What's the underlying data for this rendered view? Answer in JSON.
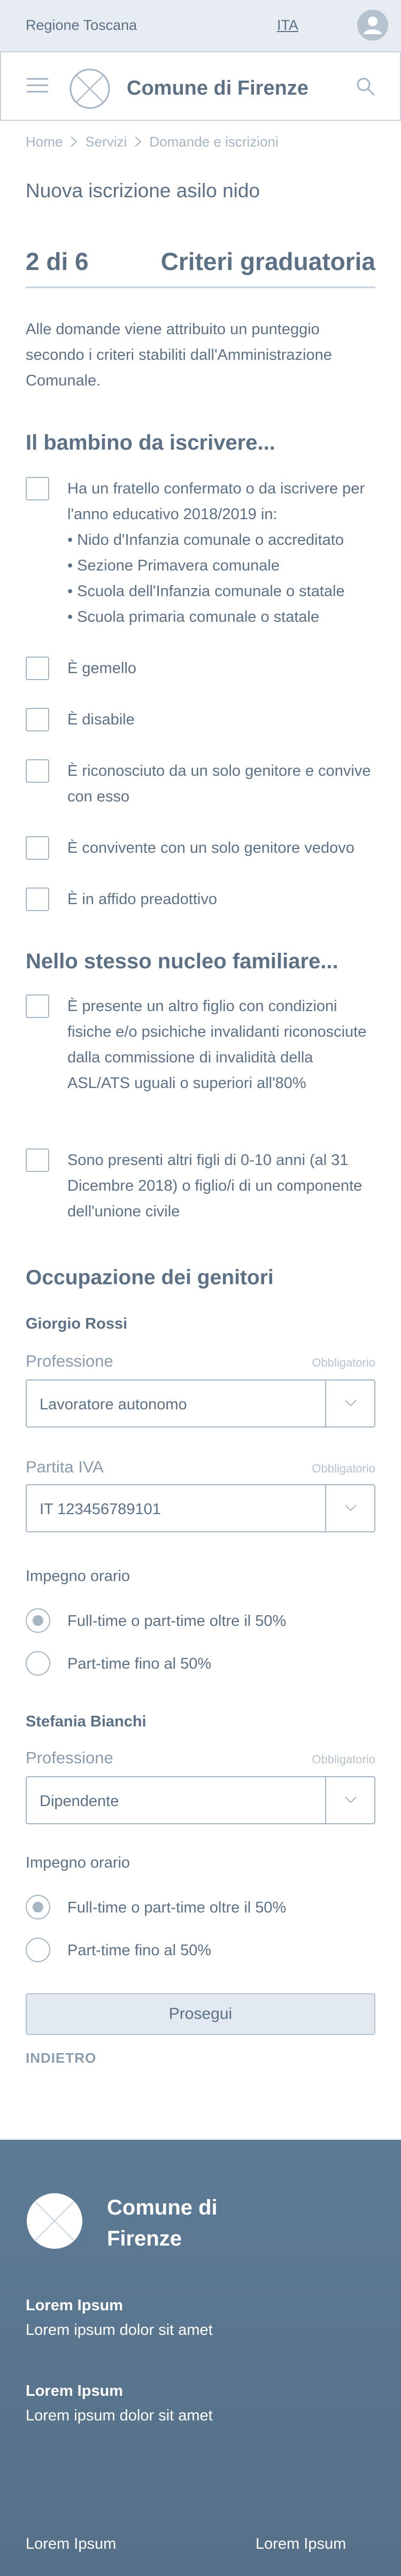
{
  "topbar": {
    "region": "Regione Toscana",
    "language": "ITA"
  },
  "header": {
    "site_title": "Comune di Firenze"
  },
  "breadcrumb": [
    "Home",
    "Servizi",
    "Domande e iscrizioni"
  ],
  "page_title": "Nuova iscrizione asilo nido",
  "step": {
    "number": "2 di 6",
    "name": "Criteri graduatoria"
  },
  "intro": "Alle domande viene attribuito un punteggio secondo i criteri stabiliti dall'Amministrazione Comunale.",
  "child_section": {
    "title": "Il bambino da iscrivere...",
    "sibling_option": {
      "label": "Ha un fratello confermato o da iscrivere per l'anno educativo 2018/2019 in:",
      "bullets": [
        "Nido d'Infanzia comunale o accreditato",
        "Sezione Primavera comunale",
        "Scuola dell'Infanzia comunale o statale",
        "Scuola primaria comunale o statale"
      ]
    },
    "options": [
      "È gemello",
      "È disabile",
      "È riconosciuto da un solo genitore e convive con esso",
      "È convivente con un solo genitore vedovo",
      "È in affido preadottivo"
    ]
  },
  "family_section": {
    "title": "Nello stesso nucleo familiare...",
    "options": [
      "È presente un altro figlio con condizioni fisiche e/o psichiche invalidanti riconosciute dalla commissione di invalidità della ASL/ATS uguali o superiori all'80%",
      "Sono presenti altri figli di 0-10 anni (al 31 Dicembre 2018) o figlio/i di un componente dell'unione civile"
    ]
  },
  "parents_section": {
    "title": "Occupazione dei genitori",
    "required": "Obbligatorio",
    "parent1": {
      "name": "Giorgio Rossi",
      "profession_label": "Professione",
      "profession_value": "Lavoratore autonomo",
      "vat_label": "Partita IVA",
      "vat_value": "IT 123456789101",
      "hours_label": "Impegno orario",
      "hours_options": [
        "Full-time o part-time oltre il 50%",
        "Part-time fino al 50%"
      ],
      "hours_selected": 0
    },
    "parent2": {
      "name": "Stefania Bianchi",
      "profession_label": "Professione",
      "profession_value": "Dipendente",
      "hours_label": "Impegno orario",
      "hours_options": [
        "Full-time o part-time oltre il 50%",
        "Part-time fino al 50%"
      ],
      "hours_selected": 0
    }
  },
  "actions": {
    "next": "Prosegui",
    "back": "INDIETRO"
  },
  "footer": {
    "title": "Comune di Firenze",
    "blocks": [
      {
        "heading": "Lorem Ipsum",
        "text": "Lorem ipsum dolor sit amet"
      },
      {
        "heading": "Lorem Ipsum",
        "text": "Lorem ipsum dolor sit amet"
      }
    ],
    "links": [
      "Lorem Ipsum",
      "Lorem Ipsum"
    ]
  },
  "colors": {
    "text": "#5c7185",
    "topbar_bg": "#e7ecf2",
    "border": "#a6b5c3",
    "button_bg": "#e2e9f1",
    "footer_bg": "#5a7690"
  }
}
